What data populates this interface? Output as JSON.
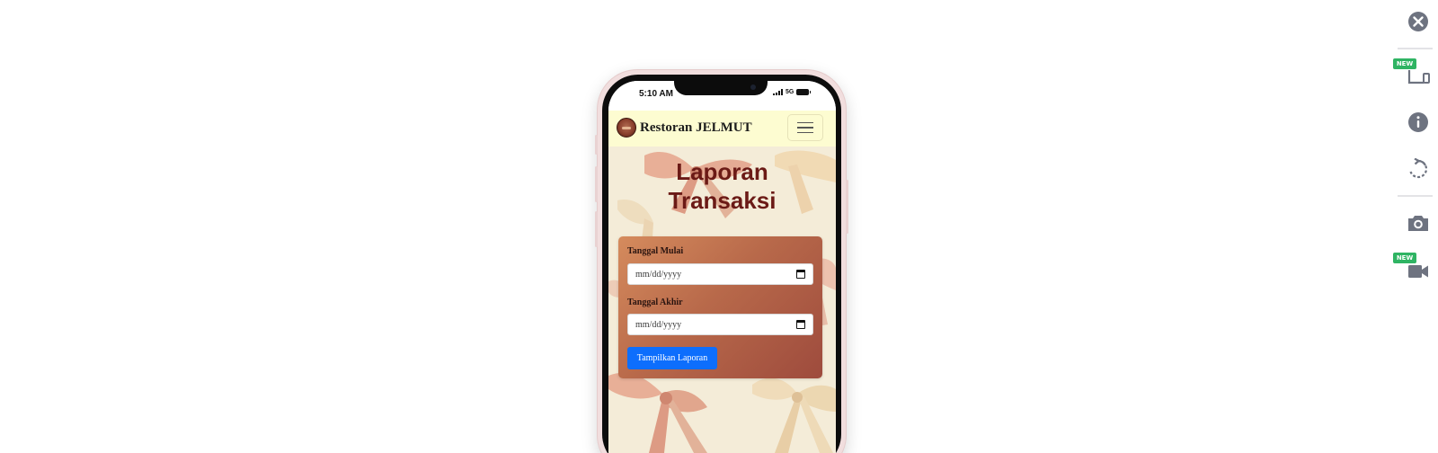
{
  "phone": {
    "status_time": "5:10 AM",
    "network": "5G"
  },
  "navbar": {
    "brand": "Restoran JELMUT",
    "logo_icon": "restaurant-logo-icon",
    "menu_icon": "hamburger-menu-icon"
  },
  "page": {
    "title_line1": "Laporan",
    "title_line2": "Transaksi"
  },
  "form": {
    "start_label": "Tanggal Mulai",
    "start_placeholder": "mm/dd/yyyy",
    "end_label": "Tanggal Akhir",
    "end_placeholder": "mm/dd/yyyy",
    "submit_label": "Tampilkan Laporan"
  },
  "toolbar": {
    "badge_new": "NEW",
    "icons": [
      "close-icon",
      "device-icon",
      "info-icon",
      "rotate-icon",
      "camera-icon",
      "video-icon"
    ]
  },
  "colors": {
    "navbar_bg": "#fdfcd1",
    "title": "#6b1a16",
    "button": "#0d6efd",
    "badge": "#2fb463",
    "toolbar_icon": "#6e7380"
  }
}
